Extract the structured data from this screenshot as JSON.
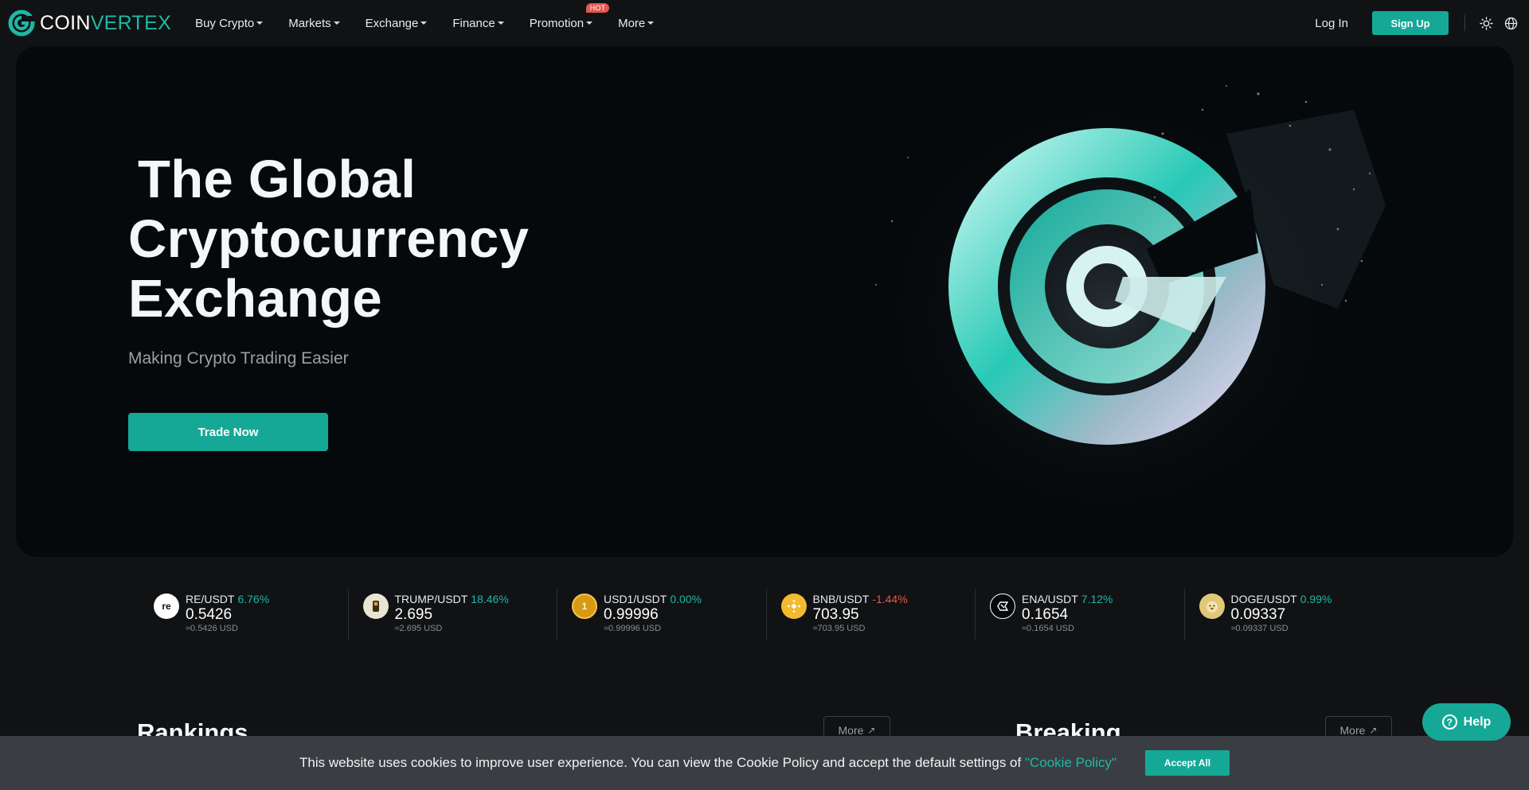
{
  "header": {
    "logo_part1": "COIN",
    "logo_part2": "VERTEX",
    "nav": [
      {
        "label": "Buy Crypto"
      },
      {
        "label": "Markets"
      },
      {
        "label": "Exchange"
      },
      {
        "label": "Finance"
      },
      {
        "label": "Promotion",
        "badge": "HOT"
      },
      {
        "label": "More"
      }
    ],
    "login": "Log In",
    "signup": "Sign Up",
    "icons": [
      "theme-sun-icon",
      "globe-icon"
    ]
  },
  "hero": {
    "title_line1": "The Global",
    "title_line2": "Cryptocurrency",
    "title_line3": "Exchange",
    "subtitle": "Making Crypto Trading Easier",
    "cta": "Trade Now"
  },
  "ticker": [
    {
      "pair": "RE/USDT",
      "change": "6.76%",
      "direction": "up",
      "price": "0.5426",
      "usd": "≈0.5426 USD",
      "icon": "re-coin-icon",
      "icon_text": "re",
      "icon_bg": "#ffffff",
      "icon_fg": "#111111"
    },
    {
      "pair": "TRUMP/USDT",
      "change": "18.46%",
      "direction": "up",
      "price": "2.695",
      "usd": "≈2.695 USD",
      "icon": "trump-coin-icon",
      "icon_text": "",
      "icon_bg": "#e9e4d4",
      "icon_fg": "#3a2e12"
    },
    {
      "pair": "USD1/USDT",
      "change": "0.00%",
      "direction": "up",
      "price": "0.99996",
      "usd": "≈0.99996 USD",
      "icon": "usd1-coin-icon",
      "icon_text": "1",
      "icon_bg": "#d99a13",
      "icon_fg": "#fff2c8"
    },
    {
      "pair": "BNB/USDT",
      "change": "-1.44%",
      "direction": "down",
      "price": "703.95",
      "usd": "≈703.95 USD",
      "icon": "bnb-coin-icon",
      "icon_text": "",
      "icon_bg": "#f3ba2f",
      "icon_fg": "#ffffff"
    },
    {
      "pair": "ENA/USDT",
      "change": "7.12%",
      "direction": "up",
      "price": "0.1654",
      "usd": "≈0.1654 USD",
      "icon": "ena-coin-icon",
      "icon_text": "",
      "icon_bg": "#05090b",
      "icon_fg": "#ffffff"
    },
    {
      "pair": "DOGE/USDT",
      "change": "0.99%",
      "direction": "up",
      "price": "0.09337",
      "usd": "≈0.09337 USD",
      "icon": "doge-coin-icon",
      "icon_text": "",
      "icon_bg": "#e1c879",
      "icon_fg": "#8a6d2b"
    }
  ],
  "sections": {
    "rankings_title": "Rankings",
    "breaking_title": "Breaking",
    "more_label": "More"
  },
  "help": {
    "label": "Help"
  },
  "cookie": {
    "text": "This website uses cookies to improve user experience. You can view the Cookie Policy and accept the default settings of ",
    "link": "\"Cookie Policy\"",
    "accept": "Accept All"
  },
  "colors": {
    "accent": "#16a897",
    "accent_text": "#20b7a6",
    "negative": "#e4574c",
    "background": "#101214",
    "hero_background": "#05090b"
  }
}
